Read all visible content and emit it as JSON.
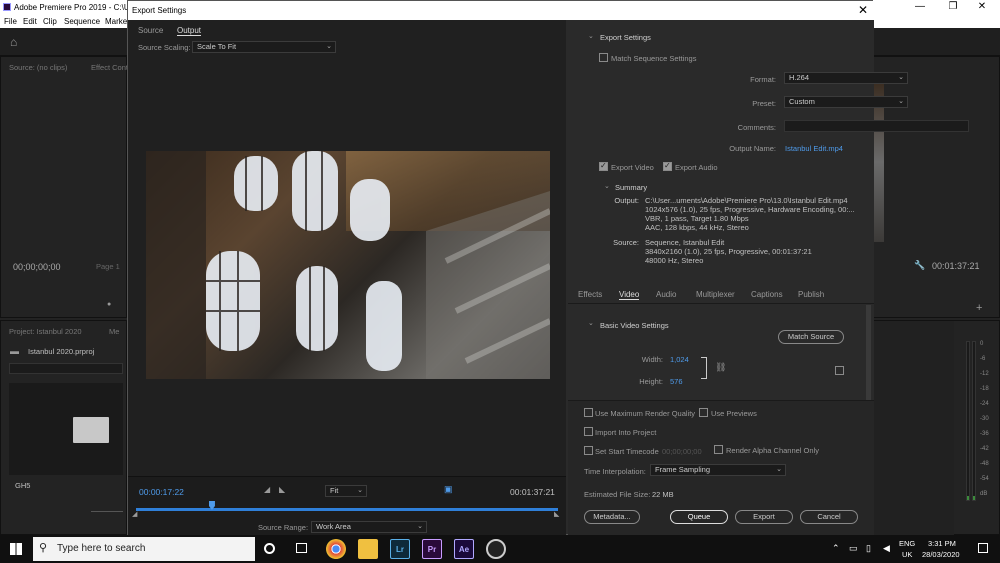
{
  "premiere": {
    "title": "Adobe Premiere Pro 2019 - C:\\Us",
    "menu": [
      "File",
      "Edit",
      "Clip",
      "Sequence",
      "Marke"
    ],
    "source_tab": "Source: (no clips)",
    "effect_tab": "Effect Contr",
    "timecode_left": "00;00;00;00",
    "page_label": "Page 1",
    "project_tab": "Project: Istanbul 2020",
    "media_tab": "Me",
    "project_file": "Istanbul 2020.prproj",
    "bin_label": "GH5",
    "timecode_right": "00:01:37:21",
    "meter_labels": [
      "0",
      "-6",
      "-12",
      "-18",
      "-24",
      "-30",
      "-36",
      "-42",
      "-48",
      "-54",
      "dB"
    ]
  },
  "dialog": {
    "title": "Export Settings",
    "tabs": {
      "source": "Source",
      "output": "Output"
    },
    "source_scaling_label": "Source Scaling:",
    "source_scaling_value": "Scale To Fit",
    "timeline": {
      "current_time": "00:00:17:22",
      "end_time": "00:01:37:21",
      "zoom": "Fit",
      "playhead_fraction": 0.18,
      "source_range_label": "Source Range:",
      "source_range_value": "Work Area"
    },
    "export_settings": {
      "heading": "Export Settings",
      "match_sequence": "Match Sequence Settings",
      "format_label": "Format:",
      "format_value": "H.264",
      "preset_label": "Preset:",
      "preset_value": "Custom",
      "comments_label": "Comments:",
      "output_name_label": "Output Name:",
      "output_name_value": "Istanbul Edit.mp4",
      "export_video": "Export Video",
      "export_audio": "Export Audio"
    },
    "summary": {
      "heading": "Summary",
      "output_label": "Output:",
      "output_lines": [
        "C:\\User...uments\\Adobe\\Premiere Pro\\13.0\\Istanbul Edit.mp4",
        "1024x576 (1.0), 25 fps, Progressive, Hardware Encoding, 00:...",
        "VBR, 1 pass, Target 1.80 Mbps",
        "AAC, 128 kbps, 44 kHz, Stereo"
      ],
      "source_label": "Source:",
      "source_lines": [
        "Sequence, Istanbul Edit",
        "3840x2160 (1.0), 25 fps, Progressive, 00:01:37:21",
        "48000 Hz, Stereo"
      ]
    },
    "settings_tabs": [
      "Effects",
      "Video",
      "Audio",
      "Multiplexer",
      "Captions",
      "Publish"
    ],
    "video": {
      "heading": "Basic Video Settings",
      "match_source": "Match Source",
      "width_label": "Width:",
      "width_value": "1,024",
      "height_label": "Height:",
      "height_value": "576"
    },
    "bottom": {
      "max_render": "Use Maximum Render Quality",
      "use_previews": "Use Previews",
      "import_project": "Import Into Project",
      "start_timecode": "Set Start Timecode",
      "start_timecode_value": "00;00;00;00",
      "render_alpha": "Render Alpha Channel Only",
      "time_interp_label": "Time Interpolation:",
      "time_interp_value": "Frame Sampling",
      "file_size_label": "Estimated File Size:",
      "file_size_value": "22 MB",
      "metadata": "Metadata...",
      "queue": "Queue",
      "export": "Export",
      "cancel": "Cancel"
    }
  },
  "taskbar": {
    "search_placeholder": "Type here to search",
    "apps": [
      "Lr",
      "Pr",
      "Ae"
    ],
    "lang_top": "ENG",
    "lang_bottom": "UK",
    "time": "3:31 PM",
    "date": "28/03/2020"
  }
}
